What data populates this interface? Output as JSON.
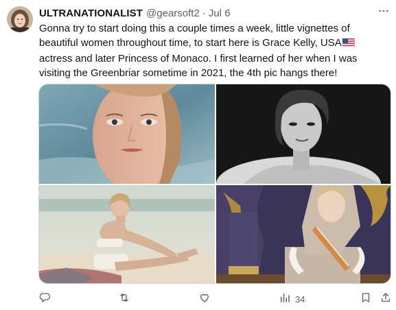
{
  "tweet": {
    "display_name": "ULTRANATIONALIST",
    "handle": "@gearsoft2",
    "separator": "·",
    "date": "Jul 6",
    "text": "Gonna try to start doing this a couple times a week, little vignettes of beautiful women throughout time, to start here is Grace Kelly, USA",
    "text_after_flag": "actress and later Princess of Monaco. I first learned of her when I was visiting the Greenbriar sometime in 2021, the 4th pic hangs there!",
    "flag_icon": "us-flag-icon"
  },
  "media": {
    "photo_count": 4
  },
  "actions": {
    "reply_icon": "reply-icon",
    "repost_icon": "repost-icon",
    "like_icon": "like-icon",
    "views_icon": "views-icon",
    "views_count": "34",
    "bookmark_icon": "bookmark-icon",
    "share_icon": "share-icon"
  },
  "colors": {
    "text": "#0f1419",
    "secondary": "#536471",
    "border": "#cfd9de"
  }
}
